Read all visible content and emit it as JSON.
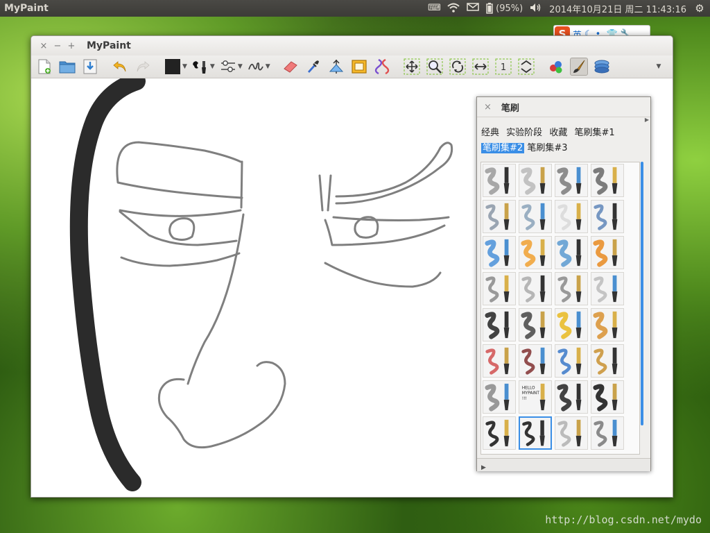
{
  "top_panel": {
    "app_name": "MyPaint",
    "battery": "(95%)",
    "datetime": "2014年10月21日 周二 11:43:16"
  },
  "ime": {
    "mode": "英",
    "logo": "S"
  },
  "window": {
    "title": "MyPaint",
    "controls": {
      "close": "×",
      "minimize": "−",
      "maximize": "+"
    }
  },
  "toolbar": {
    "tools": [
      "new-document-icon",
      "open-folder-icon",
      "save-icon",
      "undo-icon",
      "redo-icon",
      "color-swatch-icon",
      "brush-preset-icon",
      "brush-settings-icon",
      "stroke-mode-icon",
      "eraser-icon",
      "color-picker-icon",
      "symmetry-icon",
      "frame-icon",
      "path-icon",
      "pan-icon",
      "zoom-icon",
      "rotate-icon",
      "mirror-icon",
      "reset-zoom-icon",
      "fit-view-icon",
      "color-palette-icon",
      "brush-panel-toggle-icon",
      "layers-icon",
      "more-icon"
    ],
    "color": "#222222"
  },
  "brush_panel": {
    "title": "笔刷",
    "close": "×",
    "tabs": [
      {
        "label": "经典",
        "active": false
      },
      {
        "label": "实验阶段",
        "active": false
      },
      {
        "label": "收藏",
        "active": false
      },
      {
        "label": "笔刷集#1",
        "active": false
      },
      {
        "label": "笔刷集#2",
        "active": true
      },
      {
        "label": "笔刷集#3",
        "active": false
      }
    ],
    "selected_brush": "row 8, column 2",
    "brush_label_hello": "HELLO",
    "brush_label_mypaint": "MYPAINT",
    "brush_label_bang": "!!!"
  },
  "watermark": "http://blog.csdn.net/mydo"
}
